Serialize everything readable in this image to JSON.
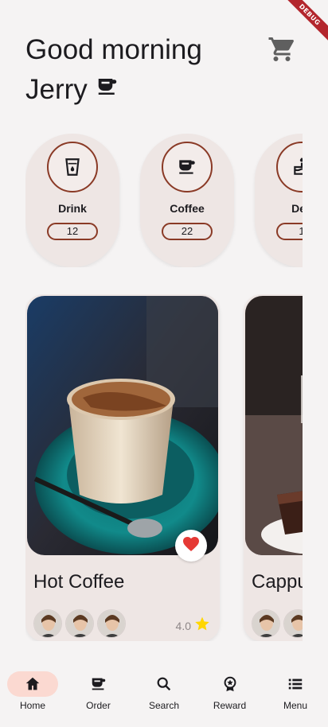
{
  "debug_banner": "DEBUG",
  "header": {
    "greeting": "Good morning",
    "user_name": "Jerry"
  },
  "categories": [
    {
      "label": "Drink",
      "count": "12",
      "icon": "glass-water-icon"
    },
    {
      "label": "Coffee",
      "count": "22",
      "icon": "coffee-cup-icon"
    },
    {
      "label": "Des",
      "count": "1",
      "icon": "cake-icon"
    }
  ],
  "products": [
    {
      "name": "Hot Coffee",
      "rating": "4.0",
      "favorite": true
    },
    {
      "name": "Cappu",
      "rating": "",
      "favorite": false
    }
  ],
  "nav": {
    "active": "Home",
    "items": [
      {
        "label": "Home",
        "icon": "home-icon"
      },
      {
        "label": "Order",
        "icon": "coffee-cup-icon"
      },
      {
        "label": "Search",
        "icon": "search-icon"
      },
      {
        "label": "Reward",
        "icon": "badge-icon"
      },
      {
        "label": "Menu",
        "icon": "list-icon"
      }
    ]
  },
  "colors": {
    "accent_brown": "#8a3a26",
    "card_bg": "#eee6e4",
    "nav_active": "#fbd9d1",
    "favorite_red": "#e53935",
    "star_yellow": "#ffd600"
  }
}
